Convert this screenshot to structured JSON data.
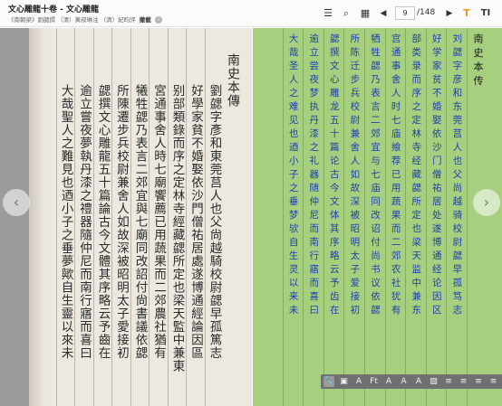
{
  "header": {
    "title": "文心雕龍十卷 - 文心雕龍",
    "subtitle": "《南朝梁》劉勰撰 （清）黃叔琳注 （清）紀昀評",
    "meta_label": "撤載",
    "info_icon": "info-icon"
  },
  "toolbar": {
    "icons": [
      "list-icon",
      "search-icon",
      "grid-icon",
      "prev-page-icon",
      "next-page-icon",
      "text-toggle-icon",
      "vertical-text-icon"
    ],
    "page_current": "9",
    "page_total": "/148",
    "accent_color": "#e99a2a"
  },
  "scan": {
    "heading": "南史本傳",
    "columns": [
      "劉勰字彥和東莞莒人也父尙越騎校尉勰早孤篤志",
      "好學家貧不婚娶依沙門僧祐居處遂博通經論因區",
      "别部類錄而序之定林寺經藏勰所定也梁天監中兼東",
      "宮通事舍人時七廟饗薦已用蔬果而二郊農社猶有",
      "犧牲勰乃表言二郊宜與七廟同改詔付尙書議依勰",
      "所陳遷步兵校尉兼舍人如故深被昭明太子愛接初",
      "勰撰文心雕龍五十篇論古今文體其序略云予齒在",
      "逾立嘗夜夢執丹漆之禮器隨仲尼而南行寤而喜曰",
      "大哉聖人之難見也迺小子之垂夢歟自生靈以來未"
    ]
  },
  "text": {
    "heading": "南史本传",
    "columns": [
      "刘勰字彦和东莞莒人也父尚越骑校尉勰早孤笃志",
      "好学家贫不婚娶依沙门僧祐居处遂博通经论因区",
      "部类录而序之定林寺经藏勰所定也梁天监中兼东",
      "宫通事舍人时七庙飨荐已用蔬果而二郊农社犹有",
      "牺牲勰乃表言二郊宜与七庙同改诏付尚书议依勰",
      "所陈迁步兵校尉兼舍人如故深被昭明太子爱接初",
      "勰撰文心雕龙五十篇论古今文体其序略云予齿在",
      "逾立尝夜梦执丹漆之礼器随仲尼而南行寤而喜曰",
      "大哉圣人之难见也迺小子之垂梦欤自生灵以来未"
    ],
    "background": "#a6cf7e",
    "text_color": "#1f3fae"
  },
  "navigation": {
    "prev": "‹",
    "next": "›"
  },
  "float_toolbar": {
    "icons": [
      "wrench-icon",
      "image-icon",
      "font-size-decrease-icon",
      "font-icon",
      "font-large-icon",
      "font-small-icon",
      "font-medium-icon",
      "picture-icon",
      "align-left-icon",
      "align-center-icon",
      "align-right-icon",
      "align-justify-icon"
    ],
    "glyphs": [
      "🔧",
      "▣",
      "A",
      "Ft",
      "A",
      "A",
      "A",
      "▨",
      "≡",
      "≡",
      "≡",
      "≡"
    ]
  }
}
